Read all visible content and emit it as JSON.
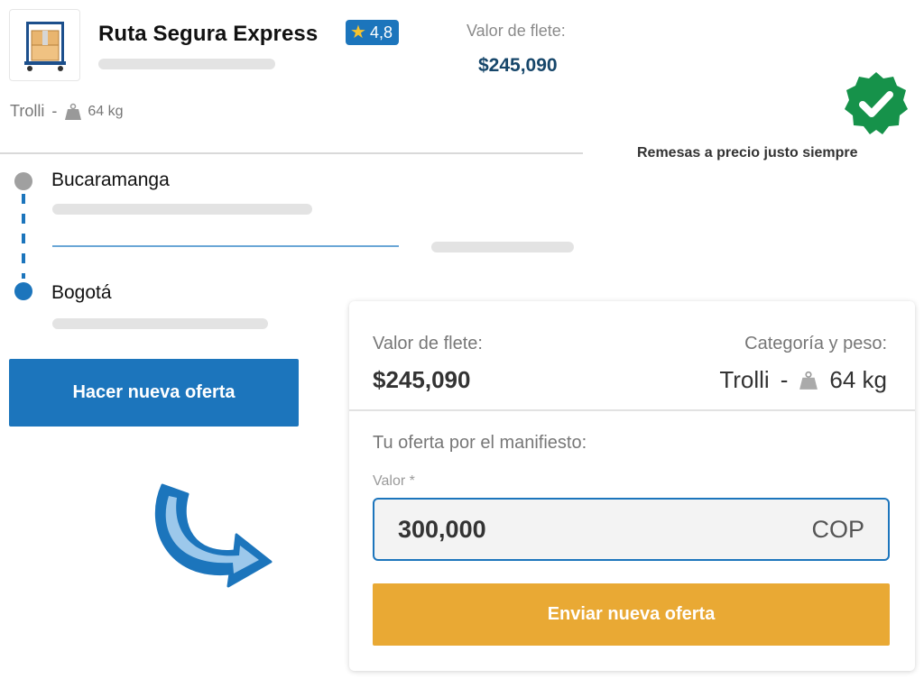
{
  "carrier": {
    "name": "Ruta Segura Express",
    "rating": "4,8",
    "freight_label": "Valor de flete:",
    "freight_value": "$245,090",
    "category": "Trolli",
    "category_separator": "-",
    "weight": "64 kg",
    "icons": {
      "vehicle": "trolley-icon",
      "rating": "star-icon",
      "weight": "weight-icon"
    }
  },
  "badge": {
    "text": "Remesas a precio justo siempre",
    "icon": "verified-check-icon",
    "color": "#16924a"
  },
  "route": {
    "origin": "Bucaramanga",
    "destination": "Bogotá"
  },
  "actions": {
    "new_offer_label": "Hacer nueva oferta"
  },
  "offer_panel": {
    "freight_label": "Valor de flete:",
    "freight_value": "$245,090",
    "category_label": "Categoría y peso:",
    "category": "Trolli",
    "category_separator": "-",
    "weight": "64 kg",
    "offer_title": "Tu oferta por el manifiesto:",
    "input_label": "Valor *",
    "input_value": "300,000",
    "currency": "COP",
    "submit_label": "Enviar nueva oferta"
  },
  "colors": {
    "primary": "#1c75bc",
    "accent": "#e9a934",
    "freight_value": "#16466a"
  }
}
